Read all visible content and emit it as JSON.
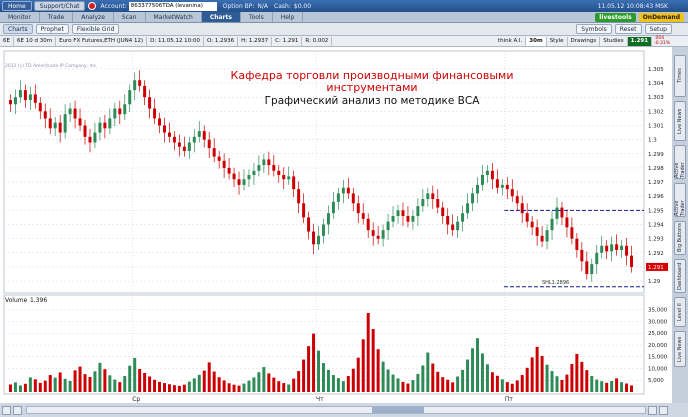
{
  "topbar": {
    "home": "Home",
    "support": "Support/Chat",
    "account_label": "Account:",
    "account_value": "863377506TDA (levanina)",
    "option_bp_label": "Option BP:",
    "option_bp_value": "N/A",
    "cash_label": "Cash:",
    "cash_value": "$0.00",
    "datetime": "11.05.12 10:08:43 MSK"
  },
  "tabs": [
    "Monitor",
    "Trade",
    "Analyze",
    "Scan",
    "MarketWatch",
    "Charts",
    "Tools",
    "Help"
  ],
  "active_tab": "Charts",
  "brand": {
    "livestools": "livestools",
    "ondemand": "OnDemand"
  },
  "subbar": {
    "charts": "Charts",
    "prophet": "Prophet",
    "flexible_grid": "Flexible Grid",
    "symbols": "Symbols",
    "reset": "Reset",
    "setup": "Setup"
  },
  "chartbar": {
    "symbol": "6E",
    "interval": "6E 10 d 30m",
    "description": "Euro FX Futures,ETH (JUN4 12)",
    "d": "D: 11.05.12 10:00",
    "o": "O: 1.2936",
    "h": "H: 1.2937",
    "c": "C: 1.291",
    "r": "R: 0.002",
    "think": "think A.I.",
    "timeframe": "30m",
    "style": "Style",
    "drawings": "Drawings",
    "studies": "Studies",
    "last": "1.291",
    "change": ".004",
    "pct": "-0.31%"
  },
  "copyright": "2012 (c) TD Ameritrade IP Company, Inc.",
  "annotation": {
    "line1": "Кафедра торговли производными финансовыми",
    "line2": "инструментами",
    "line3": "Графический анализ по методике ВСА"
  },
  "lines": {
    "upper_label": "",
    "lower_label": "SHL1.2896"
  },
  "volume_label": "Volume",
  "volume_value": "1,396",
  "x_labels": [
    "Ср",
    "Чт",
    "Пт"
  ],
  "right_tabs": [
    "Live News",
    "Level II",
    "Dashboard",
    "Big Buttons",
    "Active Trader",
    "Active Trader",
    "Live News",
    "Times"
  ],
  "colors": {
    "up": "#2e8b57",
    "down": "#cc0000",
    "grid": "#d6d6e6",
    "price_tag": "#d60000",
    "annotation_red": "#cc0000"
  },
  "chart_data": {
    "type": "candlestick",
    "price_ticks": [
      "1.305",
      "1.304",
      "1.303",
      "1.302",
      "1.301",
      "1.3",
      "1.299",
      "1.298",
      "1.297",
      "1.296",
      "1.295",
      "1.294",
      "1.293",
      "1.292",
      "1.291",
      "1.29"
    ],
    "ylim": [
      1.2893,
      1.3057
    ],
    "volume_ticks": [
      "35,000",
      "30,000",
      "25,000",
      "20,000",
      "15,000",
      "10,000",
      "5,000"
    ],
    "volume_ylim": [
      0,
      37000
    ],
    "last_price": "1.291",
    "hlines": [
      1.295,
      1.2896
    ],
    "closes": [
      1.3025,
      1.303,
      1.3035,
      1.3028,
      1.3032,
      1.3026,
      1.302,
      1.3015,
      1.3008,
      1.3012,
      1.3005,
      1.3018,
      1.3022,
      1.3015,
      1.301,
      1.3002,
      1.2998,
      1.3005,
      1.3012,
      1.3008,
      1.3015,
      1.3022,
      1.3018,
      1.3025,
      1.3035,
      1.3042,
      1.3038,
      1.303,
      1.3022,
      1.3015,
      1.301,
      1.3005,
      1.3002,
      1.2998,
      1.2995,
      1.2992,
      1.2998,
      1.3002,
      1.3006,
      1.3,
      1.2994,
      1.2988,
      1.2985,
      1.298,
      1.2976,
      1.2972,
      1.2968,
      1.2972,
      1.2975,
      1.2978,
      1.2982,
      1.2986,
      1.2982,
      1.2978,
      1.2975,
      1.2972,
      1.2974,
      1.2965,
      1.2955,
      1.2945,
      1.2935,
      1.2926,
      1.2932,
      1.294,
      1.2948,
      1.2956,
      1.2962,
      1.2966,
      1.2962,
      1.2955,
      1.2948,
      1.2944,
      1.2936,
      1.2932,
      1.293,
      1.2936,
      1.2942,
      1.2946,
      1.295,
      1.2946,
      1.2942,
      1.2946,
      1.2953,
      1.2958,
      1.2962,
      1.2958,
      1.2952,
      1.2946,
      1.294,
      1.2936,
      1.2942,
      1.2948,
      1.2955,
      1.2962,
      1.2968,
      1.2975,
      1.2978,
      1.2972,
      1.2966,
      1.2968,
      1.2965,
      1.296,
      1.2955,
      1.2948,
      1.2942,
      1.2938,
      1.2932,
      1.2928,
      1.2936,
      1.2944,
      1.2952,
      1.2945,
      1.2938,
      1.293,
      1.2922,
      1.2914,
      1.2905,
      1.2912,
      1.292,
      1.2925,
      1.2921,
      1.2926,
      1.2922,
      1.2925,
      1.2918,
      1.291
    ],
    "volumes": [
      3200,
      4100,
      2800,
      3500,
      6200,
      5400,
      3900,
      4800,
      7200,
      6100,
      8300,
      5600,
      4700,
      9200,
      10800,
      7600,
      6400,
      8800,
      12400,
      9700,
      7100,
      5300,
      4200,
      6800,
      11200,
      14500,
      9800,
      8100,
      6600,
      5200,
      4300,
      3800,
      3300,
      2900,
      2600,
      3100,
      4400,
      5800,
      7300,
      9100,
      12600,
      8700,
      6300,
      4900,
      3700,
      3100,
      2700,
      3600,
      4800,
      6200,
      8400,
      10600,
      7900,
      6100,
      4600,
      3800,
      3200,
      5700,
      8900,
      13800,
      19500,
      24800,
      17600,
      12300,
      9400,
      7200,
      5900,
      4600,
      6800,
      9900,
      14600,
      22400,
      33600,
      26800,
      18200,
      12900,
      9600,
      7400,
      5800,
      4300,
      3600,
      5100,
      7700,
      11300,
      16800,
      12100,
      8600,
      6300,
      5200,
      4100,
      6600,
      9400,
      13800,
      18600,
      22900,
      16400,
      11800,
      8400,
      6900,
      5400,
      4200,
      3500,
      4900,
      7200,
      10300,
      14700,
      19200,
      15300,
      11600,
      8900,
      6700,
      5100,
      7400,
      11900,
      16200,
      12800,
      9300,
      6800,
      5300,
      4600,
      3900,
      4700,
      5800,
      4200,
      3600,
      2800
    ]
  }
}
